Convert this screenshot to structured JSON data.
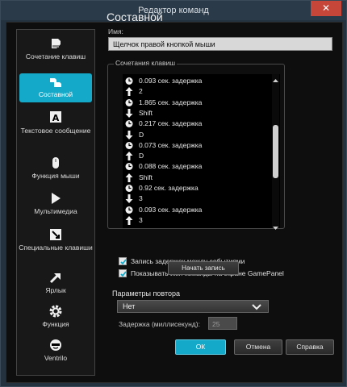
{
  "window": {
    "title": "Редактор команд",
    "close_label": "✕"
  },
  "sidebar": {
    "items": [
      {
        "label": "Сочетание клавиш",
        "icon": "keystroke-icon"
      },
      {
        "label": "Составной",
        "icon": "multikey-icon"
      },
      {
        "label": "Текстовое сообщение",
        "icon": "text-block-icon"
      },
      {
        "label": "Функция мыши",
        "icon": "mouse-icon"
      },
      {
        "label": "Мультимедиа",
        "icon": "play-icon"
      },
      {
        "label": "Специальные клавиши",
        "icon": "special-keys-icon"
      },
      {
        "label": "Ярлык",
        "icon": "shortcut-arrow-icon"
      },
      {
        "label": "Функция",
        "icon": "gear-icon"
      },
      {
        "label": "Ventrilo",
        "icon": "ventrilo-icon"
      }
    ]
  },
  "main": {
    "title": "Составной",
    "name_label": "Имя:",
    "name_value": "Щелчок правой кнопкой мыши",
    "combos_label": "Сочетания клавиш",
    "combos": [
      {
        "type": "delay",
        "text": "0.093 сек. задержка"
      },
      {
        "type": "up",
        "text": "2"
      },
      {
        "type": "delay",
        "text": "1.865 сек. задержка"
      },
      {
        "type": "down",
        "text": "Shift"
      },
      {
        "type": "delay",
        "text": "0.217 сек. задержка"
      },
      {
        "type": "down",
        "text": "D"
      },
      {
        "type": "delay",
        "text": "0.073 сек. задержка"
      },
      {
        "type": "up",
        "text": "D"
      },
      {
        "type": "delay",
        "text": "0.088 сек. задержка"
      },
      {
        "type": "up",
        "text": "Shift"
      },
      {
        "type": "delay",
        "text": "0.92 сек. задержка"
      },
      {
        "type": "down",
        "text": "3"
      },
      {
        "type": "delay",
        "text": "0.093 сек. задержка"
      },
      {
        "type": "up",
        "text": "3"
      }
    ],
    "record_delays_label": "Запись задержек между событиями",
    "record_delays_checked": true,
    "show_name_label": "Показывать имя команды на экране GamePanel",
    "show_name_checked": true,
    "start_record_label": "Начать запись",
    "repeat_label": "Параметры повтора",
    "repeat_value": "Нет",
    "delay_label": "Задержка (миллисекунд):",
    "delay_value": "25"
  },
  "footer": {
    "ok_label": "ОК",
    "cancel_label": "Отмена",
    "help_label": "Справка"
  },
  "colors": {
    "accent": "#14a9c9",
    "background": "#0e0e0e",
    "frame": "#243240"
  }
}
